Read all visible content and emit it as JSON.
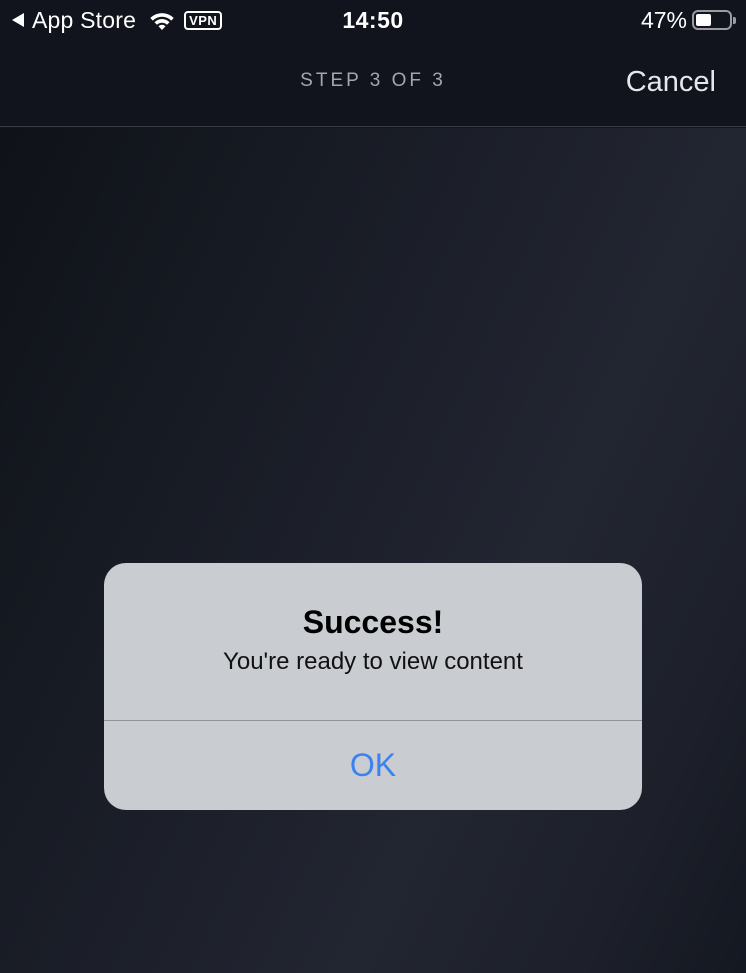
{
  "status_bar": {
    "back_app": "App Store",
    "back_icon": "back-triangle-icon",
    "wifi_icon": "wifi-icon",
    "vpn_label": "VPN",
    "time": "14:50",
    "battery_percent_text": "47%",
    "battery_level": 0.47
  },
  "nav": {
    "step_label": "STEP 3 OF 3",
    "cancel_label": "Cancel"
  },
  "alert": {
    "title": "Success!",
    "message": "You're ready to view content",
    "ok_label": "OK",
    "ok_color": "#3b82f0"
  }
}
